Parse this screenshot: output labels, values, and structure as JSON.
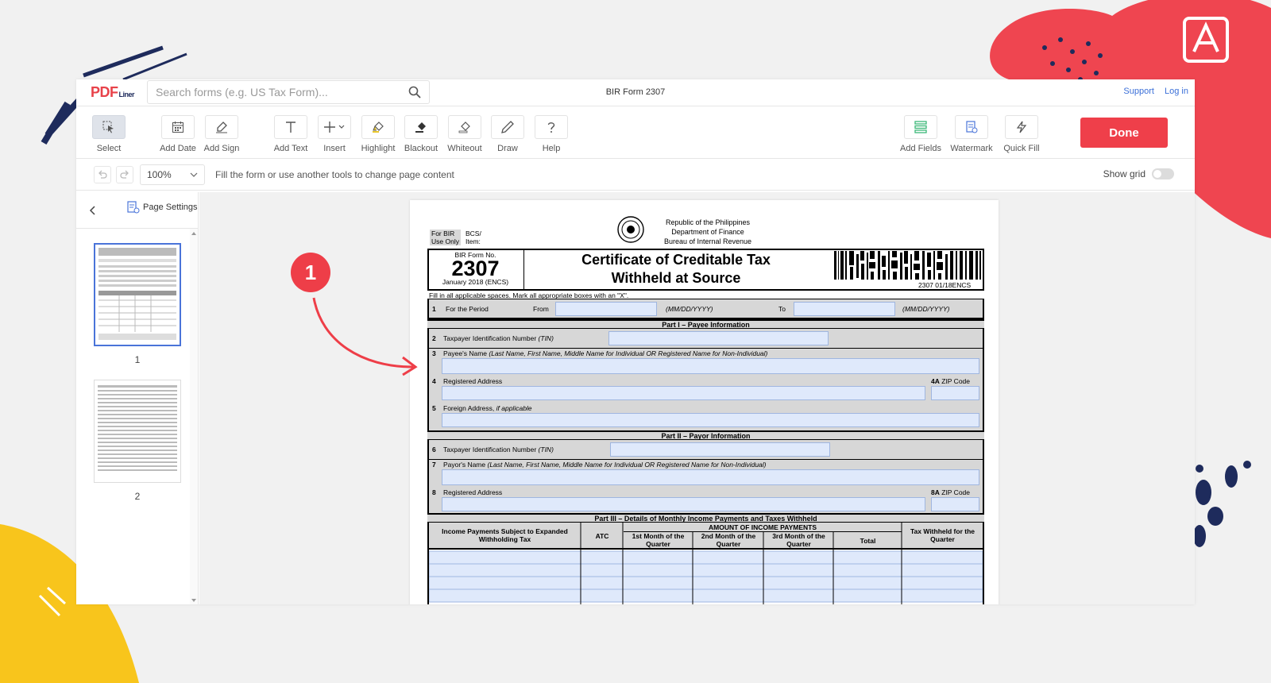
{
  "header": {
    "logo_main": "PDF",
    "logo_sub": "Liner",
    "search_placeholder": "Search forms (e.g. US Tax Form)...",
    "doc_title": "BIR Form 2307",
    "support_label": "Support",
    "login_label": "Log in"
  },
  "toolbar": {
    "select": "Select",
    "add_date": "Add Date",
    "add_sign": "Add Sign",
    "add_text": "Add Text",
    "insert": "Insert",
    "highlight": "Highlight",
    "blackout": "Blackout",
    "whiteout": "Whiteout",
    "draw": "Draw",
    "help": "Help",
    "add_fields": "Add Fields",
    "watermark": "Watermark",
    "quick_fill": "Quick Fill",
    "done": "Done"
  },
  "subbar": {
    "zoom": "100%",
    "hint": "Fill the form or use another tools to change page content",
    "show_grid": "Show grid"
  },
  "sidebar": {
    "page_settings": "Page Settings",
    "pages": [
      "1",
      "2"
    ]
  },
  "annotation": {
    "step": "1"
  },
  "form": {
    "for_bir": "For BIR",
    "use_only": "Use Only",
    "bcs": "BCS/",
    "item": "Item:",
    "republic": "Republic of the Philippines",
    "department": "Department of Finance",
    "bureau": "Bureau of Internal Revenue",
    "form_no_label": "BIR Form No.",
    "form_no": "2307",
    "form_date": "January 2018 (ENCS)",
    "title_line1": "Certificate of Creditable Tax",
    "title_line2": "Withheld at Source",
    "barcode_text": "2307 01/18ENCS",
    "instructions": "Fill in all applicable spaces. Mark all appropriate boxes with an \"X\".",
    "item1_num": "1",
    "item1_label": "For the Period",
    "from_label": "From",
    "date_format": "(MM/DD/YYYY)",
    "to_label": "To",
    "part1": "Part I – Payee Information",
    "item2_num": "2",
    "item2_label": "Taxpayer Identification Number",
    "tin_abbr": "(TIN)",
    "item3_num": "3",
    "item3_label": "Payee's Name",
    "name_note": "(Last Name, First Name, Middle Name for Individual OR Registered Name for Non-Individual)",
    "item4_num": "4",
    "item4_label": "Registered Address",
    "item4a_label": "4A",
    "zip_label": "ZIP Code",
    "item5_num": "5",
    "item5_label": "Foreign Address,",
    "item5_note": "if applicable",
    "part2": "Part II – Payor Information",
    "item6_num": "6",
    "item6_label": "Taxpayer Identification Number",
    "item7_num": "7",
    "item7_label": "Payor's Name",
    "item8_num": "8",
    "item8_label": "Registered Address",
    "item8a_label": "8A",
    "part3": "Part III – Details of Monthly Income Payments and Taxes Withheld",
    "col_income_1": "Income Payments Subject to Expanded",
    "col_income_2": "Withholding Tax",
    "col_atc": "ATC",
    "col_amount": "AMOUNT OF INCOME PAYMENTS",
    "col_m1_1": "1st Month of the",
    "col_m2_1": "2nd Month of the",
    "col_m3_1": "3rd Month of the",
    "col_quarter": "Quarter",
    "col_total": "Total",
    "col_tax_1": "Tax Withheld for the",
    "col_tax_2": "Quarter"
  }
}
